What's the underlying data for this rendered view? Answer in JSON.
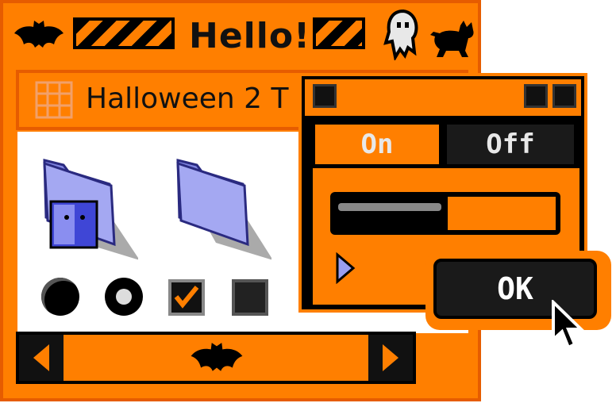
{
  "window": {
    "title": "Hello!",
    "header_label": "Halloween 2 T"
  },
  "dialog": {
    "tab_on": "On",
    "tab_off": "Off",
    "slider_value": 0.45,
    "ok_label": "OK"
  },
  "colors": {
    "accent": "#ff7f00",
    "dark": "#111111",
    "folder": "#8a8ee6"
  },
  "icons": {
    "title_left": "bat-icon",
    "title_right_1": "ghost-icon",
    "title_right_2": "black-cat-icon",
    "scroll_center": "bat-icon"
  }
}
